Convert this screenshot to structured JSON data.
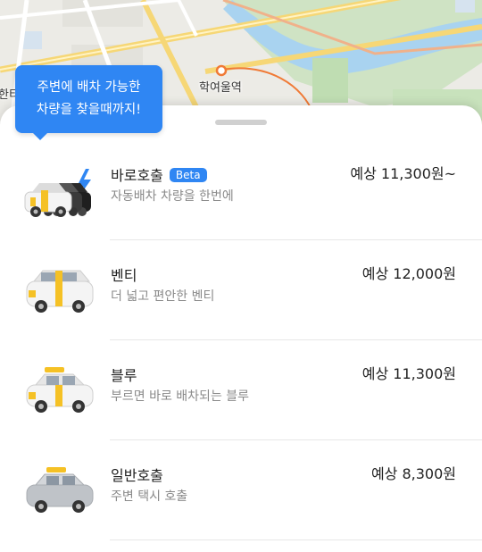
{
  "map": {
    "station": "학여울역",
    "left_label": "한티"
  },
  "tooltip": {
    "line1": "주변에 배차 가능한",
    "line2": "차량을 찾을때까지!"
  },
  "options": [
    {
      "name": "바로호출",
      "badge": "Beta",
      "desc": "자동배차 차량을 한번에",
      "price": "예상 11,300원~",
      "car": "multi-taxi-lightning-icon"
    },
    {
      "name": "벤티",
      "desc": "더 넓고 편안한 벤티",
      "price": "예상 12,000원",
      "car": "venti-van-icon"
    },
    {
      "name": "블루",
      "desc": "부르면 바로 배차되는 블루",
      "price": "예상 11,300원",
      "car": "blue-taxi-icon"
    },
    {
      "name": "일반호출",
      "desc": "주변 택시 호출",
      "price": "예상 8,300원",
      "car": "general-taxi-icon"
    }
  ],
  "colors": {
    "accent": "#2f86f3",
    "taxi_yellow": "#f5c125",
    "road": "#f6d776"
  }
}
